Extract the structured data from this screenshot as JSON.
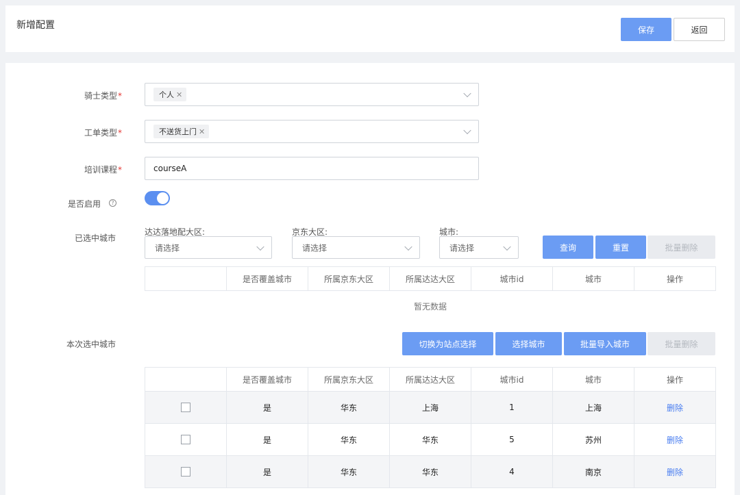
{
  "header": {
    "title": "新增配置",
    "save_label": "保存",
    "back_label": "返回"
  },
  "form": {
    "rider_type": {
      "label": "骑士类型",
      "tag": "个人"
    },
    "order_type": {
      "label": "工单类型",
      "tag": "不送货上门"
    },
    "course": {
      "label": "培训课程",
      "value": "courseA"
    },
    "enabled": {
      "label": "是否启用",
      "help": "?",
      "on": true
    },
    "required_mark": "*"
  },
  "selected_cities": {
    "label": "已选中城市",
    "filters": [
      {
        "label": "达达落地配大区:",
        "placeholder": "请选择"
      },
      {
        "label": "京东大区:",
        "placeholder": "请选择"
      },
      {
        "label": "城市:",
        "placeholder": "请选择"
      }
    ],
    "query_label": "查询",
    "reset_label": "重置",
    "batch_delete_label": "批量删除",
    "columns": [
      "",
      "是否覆盖城市",
      "所属京东大区",
      "所属达达大区",
      "城市id",
      "城市",
      "操作"
    ],
    "empty_text": "暂无数据"
  },
  "current_cities": {
    "label": "本次选中城市",
    "switch_station_label": "切换为站点选择",
    "select_city_label": "选择城市",
    "batch_import_label": "批量导入城市",
    "batch_delete_label": "批量删除",
    "columns": [
      "",
      "是否覆盖城市",
      "所属京东大区",
      "所属达达大区",
      "城市id",
      "城市",
      "操作"
    ],
    "rows": [
      {
        "cover": "是",
        "jd_region": "华东",
        "dada_region": "上海",
        "city_id": "1",
        "city": "上海",
        "action": "删除"
      },
      {
        "cover": "是",
        "jd_region": "华东",
        "dada_region": "华东",
        "city_id": "5",
        "city": "苏州",
        "action": "删除"
      },
      {
        "cover": "是",
        "jd_region": "华东",
        "dada_region": "华东",
        "city_id": "4",
        "city": "南京",
        "action": "删除"
      }
    ]
  },
  "colors": {
    "primary": "#6b9cf3",
    "switch_on": "#5b8ff0",
    "link": "#4a7ef0",
    "required": "#e53935",
    "background": "#f0f2f5"
  }
}
